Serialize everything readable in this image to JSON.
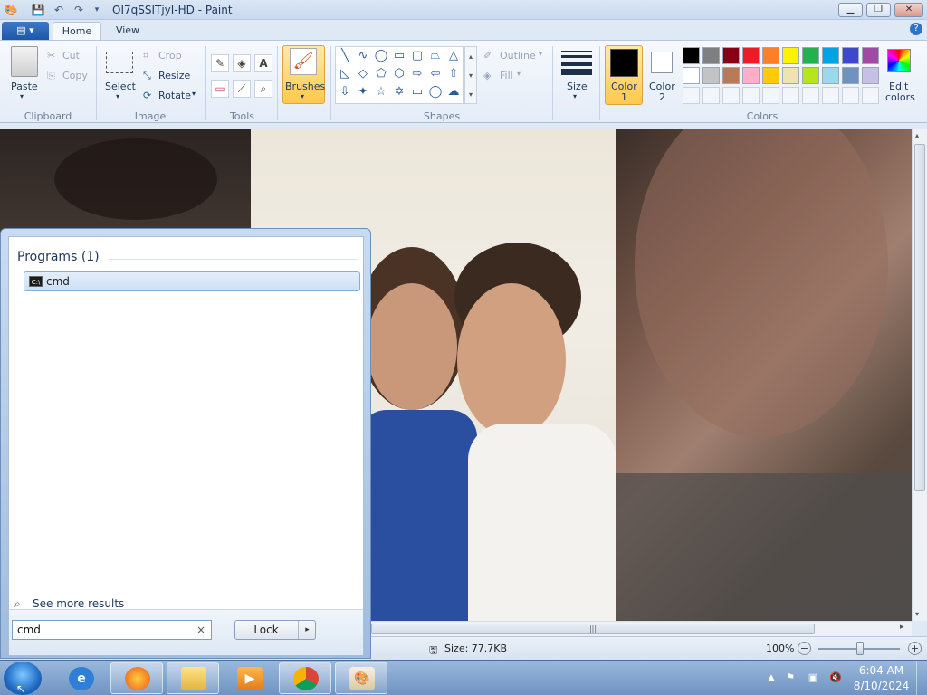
{
  "window": {
    "title": "OI7qSSITjyI-HD - Paint"
  },
  "quick_access": {
    "icons": [
      "paint-app-icon",
      "save-icon",
      "undo-icon",
      "redo-icon",
      "customize-qat-icon"
    ]
  },
  "tabs": [
    {
      "label": "Home",
      "active": true
    },
    {
      "label": "View",
      "active": false
    }
  ],
  "ribbon": {
    "clipboard": {
      "paste": "Paste",
      "cut": "Cut",
      "copy": "Copy",
      "group": "Clipboard"
    },
    "image": {
      "select": "Select",
      "crop": "Crop",
      "resize": "Resize",
      "rotate": "Rotate",
      "group": "Image"
    },
    "tools": {
      "group": "Tools"
    },
    "brushes": {
      "label": "Brushes"
    },
    "shapes": {
      "outline": "Outline",
      "fill": "Fill",
      "group": "Shapes"
    },
    "size": {
      "label": "Size"
    },
    "colors": {
      "color1": "Color",
      "color1_num": "1",
      "color2": "Color",
      "color2_num": "2",
      "edit_line1": "Edit",
      "edit_line2": "colors",
      "group": "Colors",
      "color1_value": "#000000",
      "color2_value": "#ffffff",
      "palette_row1": [
        "#000000",
        "#7f7f7f",
        "#880015",
        "#ed1c24",
        "#ff7f27",
        "#fff200",
        "#22b14c",
        "#00a2e8",
        "#3f48cc",
        "#a349a4"
      ],
      "palette_row2": [
        "#ffffff",
        "#c3c3c3",
        "#b97a57",
        "#ffaec9",
        "#ffc90e",
        "#efe4b0",
        "#b5e61d",
        "#99d9ea",
        "#7092be",
        "#c8bfe7"
      ]
    }
  },
  "statusbar": {
    "size": "Size: 77.7KB",
    "zoom": "100%"
  },
  "start_menu": {
    "programs_header": "Programs (1)",
    "programs": [
      {
        "label": "cmd"
      }
    ],
    "see_more": "See more results",
    "search_value": "cmd",
    "search_clear": "×",
    "lock_label": "Lock",
    "lock_arrow": "▸"
  },
  "taskbar": {
    "items": [
      "internet-explorer",
      "firefox",
      "file-explorer",
      "media-player",
      "chrome",
      "paint"
    ],
    "time": "6:04 AM",
    "date": "8/10/2024"
  }
}
